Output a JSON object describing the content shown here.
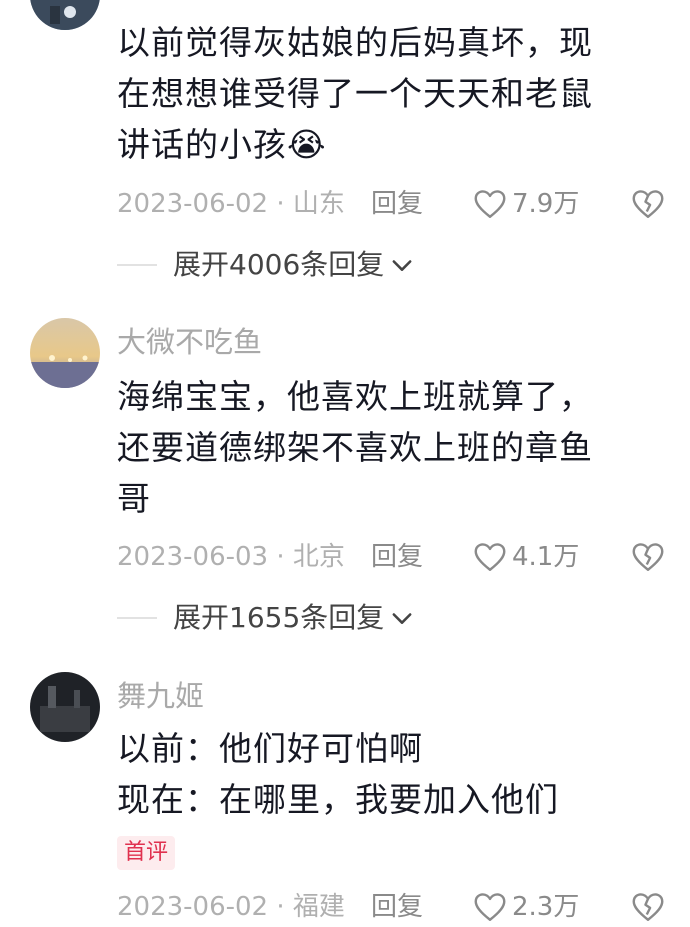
{
  "comments": [
    {
      "username": "",
      "lines": [
        "以前觉得灰姑娘的后妈真坏，现",
        "在想想谁受得了一个天天和老鼠",
        "讲话的小孩😭"
      ],
      "date_location": "2023-06-02 · 山东",
      "reply_label": "回复",
      "likes": "7.9万",
      "expand_label": "展开4006条回复"
    },
    {
      "username": "大微不吃鱼",
      "lines": [
        "海绵宝宝，他喜欢上班就算了，",
        "还要道德绑架不喜欢上班的章鱼",
        "哥"
      ],
      "date_location": "2023-06-03 · 北京",
      "reply_label": "回复",
      "likes": "4.1万",
      "expand_label": "展开1655条回复"
    },
    {
      "username": "舞九姬",
      "lines": [
        "以前：他们好可怕啊",
        "现在：在哪里，我要加入他们"
      ],
      "badge": "首评",
      "date_location": "2023-06-02 · 福建",
      "reply_label": "回复",
      "likes": "2.3万"
    }
  ],
  "colors": {
    "text": "#161823",
    "muted": "#a9a9a9",
    "badge_text": "#e0314f",
    "badge_bg": "#fdecee"
  },
  "icons": {
    "like": "heart-outline-icon",
    "dislike": "broken-heart-icon",
    "expand": "chevron-down-icon"
  }
}
